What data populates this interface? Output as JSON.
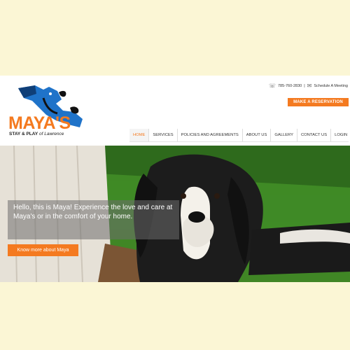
{
  "brand": {
    "name": "MAYA'S",
    "tagline_main": "STAY & PLAY",
    "tagline_of": " of Lawrence",
    "orange": "#f47a20",
    "blue": "#1f73c9"
  },
  "contact": {
    "phone_icon": "phone-icon",
    "phone": "785-760-2830",
    "separator": "|",
    "mail_icon": "mail-icon",
    "meeting": "Schedule A Meeting"
  },
  "reservation_button": "MAKE A RESERVATION",
  "nav": [
    {
      "label": "HOME"
    },
    {
      "label": "SERVICES"
    },
    {
      "label": "POLICIES AND AGREEMENTS"
    },
    {
      "label": "ABOUT US"
    },
    {
      "label": "GALLERY"
    },
    {
      "label": "CONTACT US"
    },
    {
      "label": "LOGIN"
    }
  ],
  "hero": {
    "caption": "Hello, this is Maya! Experience the love and care at Maya's or in the comfort of your home.",
    "button": "Know more about Maya"
  }
}
